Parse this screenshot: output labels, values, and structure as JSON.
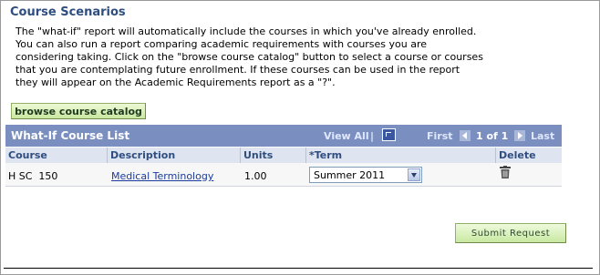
{
  "section": {
    "title": "Course Scenarios",
    "intro": "The \"what-if\" report will automatically include the courses in which you've already enrolled.\nYou can also run a report comparing academic requirements with courses you are\nconsidering taking. Click on the \"browse course catalog\" button to select a course or courses\nthat you are contemplating future enrollment. If these courses can be used in the report\nthey will appear on the Academic Requirements report as a \"?\"."
  },
  "browse_button": "browse course catalog",
  "grid": {
    "title": "What-If Course List",
    "view_all": "View All",
    "separator": "|",
    "first": "First",
    "count": "1 of 1",
    "last": "Last",
    "columns": [
      "Course",
      "Description",
      "Units",
      "*Term",
      "Delete"
    ],
    "rows": [
      {
        "course": "H SC  150",
        "description": "Medical Terminology",
        "units": "1.00",
        "term": "Summer 2011"
      }
    ]
  },
  "icons": {
    "zoom": "zoom-grid-icon",
    "prev": "arrow-left-icon",
    "next": "arrow-right-icon",
    "delete": "trash-icon"
  },
  "submit_button": "Submit Request",
  "colors": {
    "header_bar": "#7a8fc0",
    "title_text": "#2e4d80",
    "button_green": "#cbe7a0"
  }
}
